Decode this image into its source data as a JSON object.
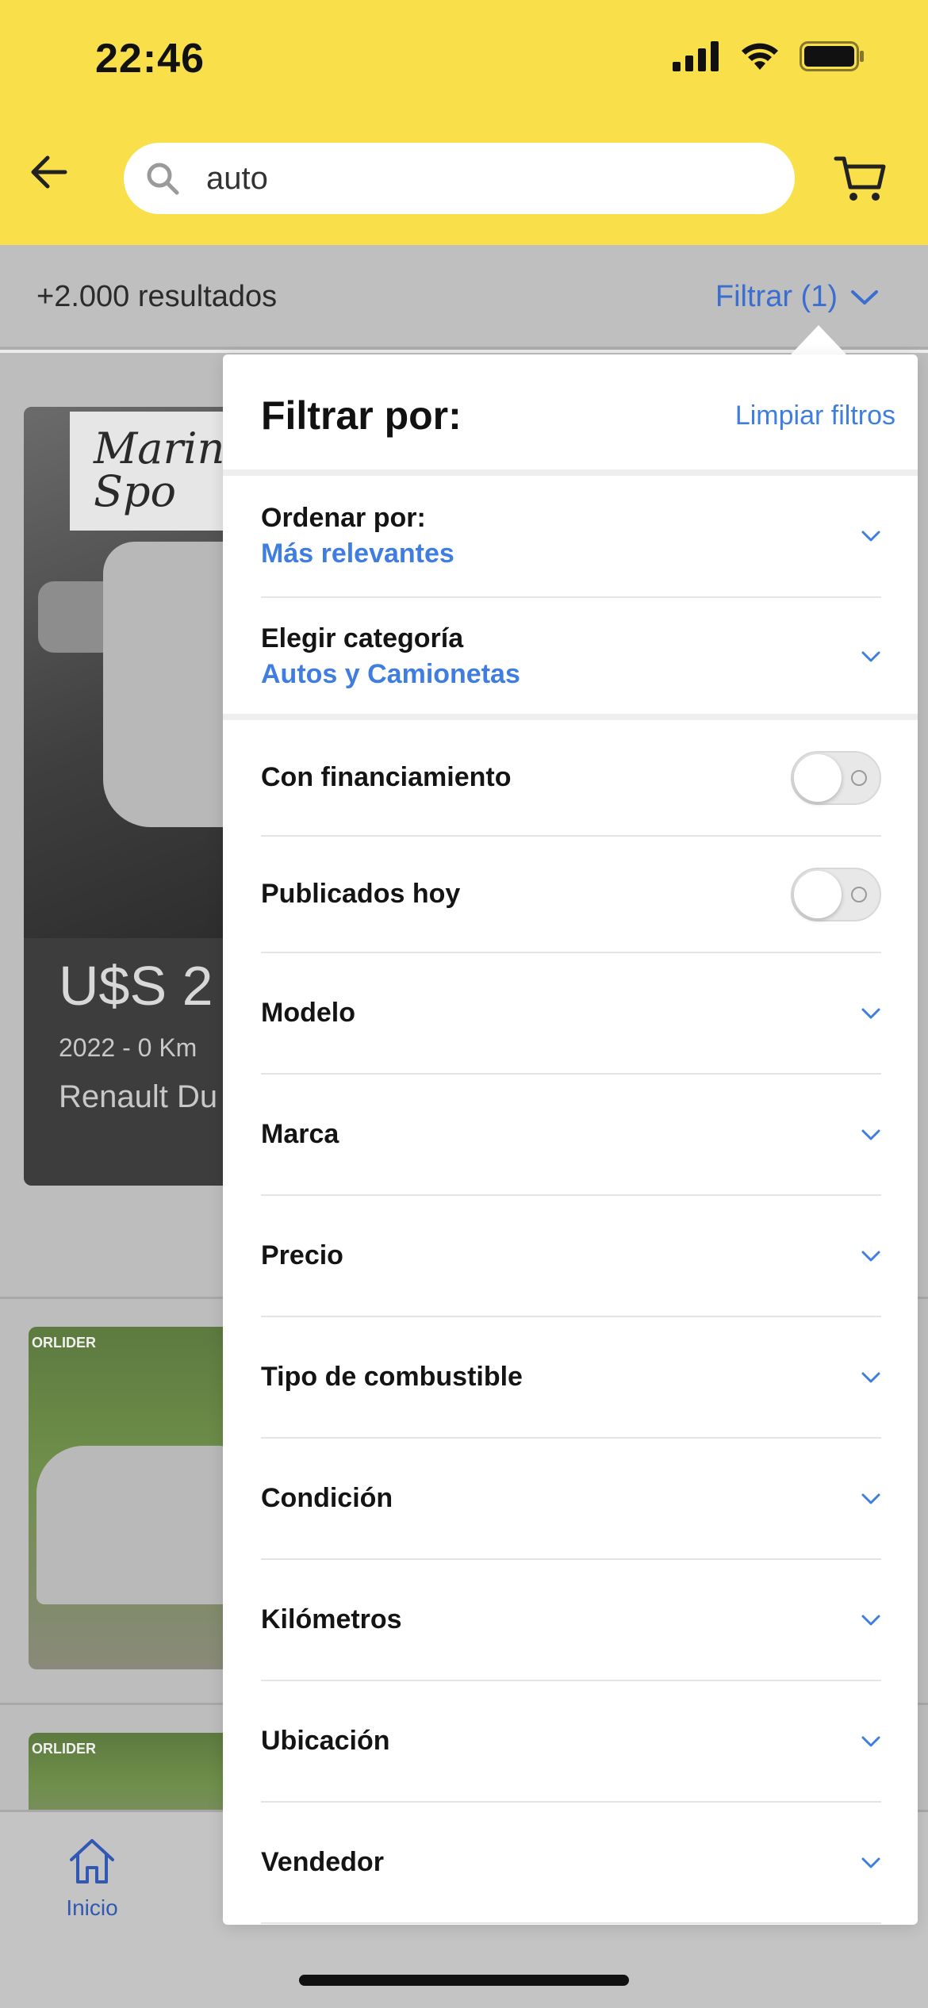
{
  "status_bar": {
    "time": "22:46"
  },
  "search": {
    "query": "auto"
  },
  "results": {
    "count_text": "+2.000 resultados",
    "filter_button": "Filtrar (1)"
  },
  "background": {
    "card1": {
      "logo_text": "Marin Spo",
      "price": "U$S 2",
      "year_km": "2022 - 0 Km",
      "model": "Renault Du"
    },
    "card2": {
      "label": "ORLIDER"
    },
    "card3": {
      "label": "ORLIDER"
    }
  },
  "bottom_nav": {
    "home": "Inicio"
  },
  "filter_panel": {
    "title": "Filtrar por:",
    "clear": "Limpiar filtros",
    "sort": {
      "label": "Ordenar por:",
      "value": "Más relevantes"
    },
    "category": {
      "label": "Elegir categoría",
      "value": "Autos y Camionetas"
    },
    "toggles": [
      {
        "label": "Con financiamiento",
        "on": false
      },
      {
        "label": "Publicados hoy",
        "on": false
      }
    ],
    "rows": [
      {
        "label": "Modelo"
      },
      {
        "label": "Marca"
      },
      {
        "label": "Precio"
      },
      {
        "label": "Tipo de combustible"
      },
      {
        "label": "Condición"
      },
      {
        "label": "Kilómetros"
      },
      {
        "label": "Ubicación"
      },
      {
        "label": "Vendedor"
      }
    ]
  },
  "colors": {
    "header": "#f9df4a",
    "accent": "#3f7ee0"
  },
  "icons": [
    "back-arrow-icon",
    "search-icon",
    "cart-icon",
    "signal-icon",
    "wifi-icon",
    "battery-icon",
    "chevron-down-icon",
    "home-icon"
  ]
}
